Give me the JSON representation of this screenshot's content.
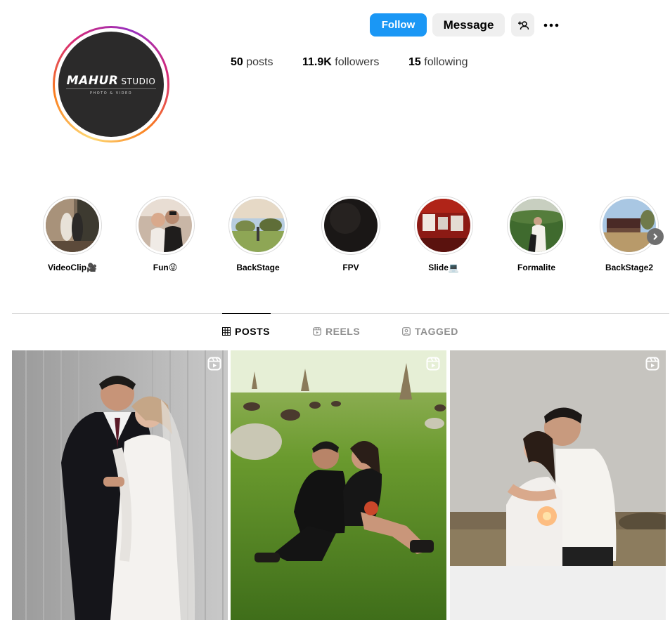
{
  "profile": {
    "logo_main": "MAHUR",
    "logo_studio": "STUDIO",
    "logo_sub": "PHOTO & VIDEO"
  },
  "actions": {
    "follow_label": "Follow",
    "message_label": "Message",
    "add_user_icon": "person-add-icon",
    "more_icon": "more-horizontal-icon"
  },
  "stats": {
    "posts_count": "50",
    "posts_label": "posts",
    "followers_count": "11.9K",
    "followers_label": "followers",
    "following_count": "15",
    "following_label": "following"
  },
  "highlights": [
    {
      "label": "VideoClip🎥"
    },
    {
      "label": "Fun😜"
    },
    {
      "label": "BackStage"
    },
    {
      "label": "FPV"
    },
    {
      "label": "Slide💻"
    },
    {
      "label": "Formalite"
    },
    {
      "label": "BackStage2"
    }
  ],
  "tabs": [
    {
      "label": "POSTS",
      "active": true,
      "icon": "grid-icon"
    },
    {
      "label": "REELS",
      "active": false,
      "icon": "reels-icon"
    },
    {
      "label": "TAGGED",
      "active": false,
      "icon": "tagged-icon"
    }
  ],
  "colors": {
    "follow_button": "#1a97f5",
    "secondary_button": "#efefef",
    "divider": "#dbdbdb",
    "muted_text": "#8e8e8e"
  }
}
